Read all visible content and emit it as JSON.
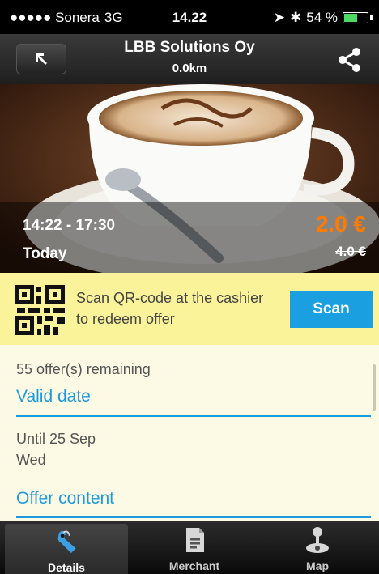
{
  "status_bar": {
    "carrier": "●●●●● Sonera",
    "network": "3G",
    "time": "14.22",
    "battery_text": "54 %",
    "battery_level": 0.54
  },
  "nav": {
    "title": "LBB Solutions Oy",
    "subtitle": "0.0km"
  },
  "offer": {
    "time_range": "14:22 - 17:30",
    "day": "Today",
    "price": "2.0 €",
    "old_price": "4.0 €"
  },
  "redeem": {
    "text": "Scan QR-code at the cashier to redeem offer",
    "scan_label": "Scan"
  },
  "details": {
    "remaining": "55 offer(s) remaining",
    "valid_title": "Valid date",
    "valid_until": "Until 25 Sep",
    "valid_day": "Wed",
    "content_title": "Offer content"
  },
  "tabs": [
    {
      "label": "Details",
      "icon": "tag-icon",
      "active": true
    },
    {
      "label": "Merchant",
      "icon": "document-icon",
      "active": false
    },
    {
      "label": "Map",
      "icon": "joystick-icon",
      "active": false
    }
  ],
  "colors": {
    "accent": "#1e9be0",
    "price": "#ff7a00",
    "redeem_bg": "#fbf39a",
    "content_bg": "#fcf9e4",
    "scan_button": "#1aa0e0"
  }
}
